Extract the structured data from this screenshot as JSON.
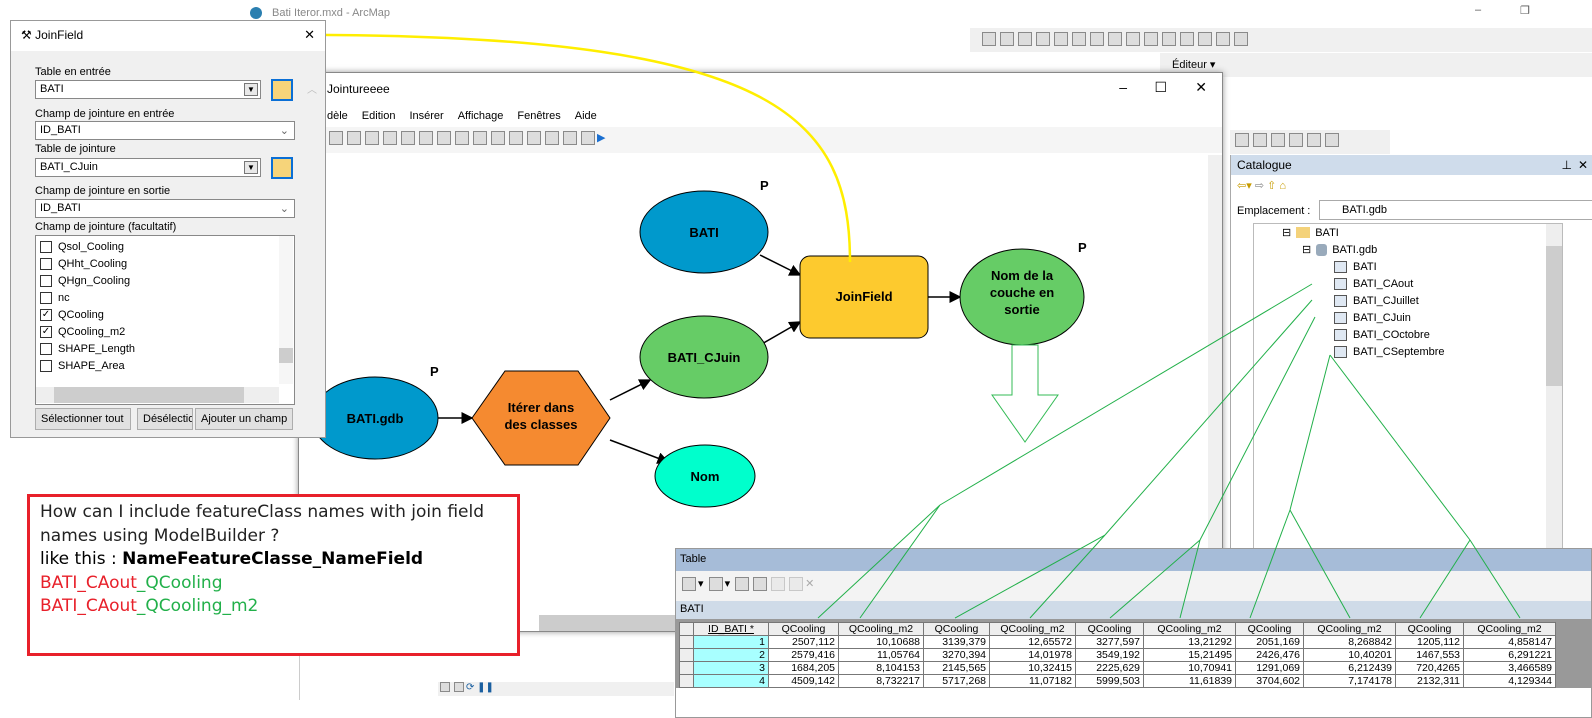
{
  "app": {
    "title": "Bati Iteror.mxd - ArcMap",
    "editor_label": "Éditeur ▾"
  },
  "joinfield": {
    "title": "JoinField",
    "close": "✕",
    "input_table_label": "Table en entrée",
    "input_table": "BATI",
    "input_field_label": "Champ de jointure en entrée",
    "input_field": "ID_BATI",
    "join_table_label": "Table de jointure",
    "join_table": "BATI_CJuin",
    "output_field_label": "Champ de jointure en sortie",
    "output_field": "ID_BATI",
    "fields_label": "Champ de jointure (facultatif)",
    "fields": [
      {
        "name": "Qsol_Cooling",
        "checked": false
      },
      {
        "name": "QHht_Cooling",
        "checked": false
      },
      {
        "name": "QHgn_Cooling",
        "checked": false
      },
      {
        "name": "nc",
        "checked": false
      },
      {
        "name": "QCooling",
        "checked": true
      },
      {
        "name": "QCooling_m2",
        "checked": true
      },
      {
        "name": "SHAPE_Length",
        "checked": false
      },
      {
        "name": "SHAPE_Area",
        "checked": false
      }
    ],
    "select_all": "Sélectionner tout",
    "deselect": "Désélectionner",
    "add_field": "Ajouter un champ"
  },
  "model": {
    "title": "Jointureeee",
    "menu": [
      "dèle",
      "Edition",
      "Insérer",
      "Affichage",
      "Fenêtres",
      "Aide"
    ],
    "nodes": {
      "bati": "BATI",
      "joinfield": "JoinField",
      "output": "Nom de la couche en sortie",
      "bati_cjuin": "BATI_CJuin",
      "bati_gdb": "BATI.gdb",
      "iterate": "Itérer dans des classes",
      "nom": "Nom",
      "param": "P"
    },
    "colors": {
      "blue": "#0099cc",
      "yellow": "#fdca2e",
      "green": "#66cc66",
      "orange": "#f58a30",
      "cyan": "#00ffcc"
    }
  },
  "catalogue": {
    "title": "Catalogue",
    "location_label": "Emplacement :",
    "location": "BATI.gdb",
    "folder": "BATI",
    "gdb": "BATI.gdb",
    "items": [
      "BATI",
      "BATI_CAout",
      "BATI_CJuillet",
      "BATI_CJuin",
      "BATI_COctobre",
      "BATI_CSeptembre"
    ]
  },
  "table": {
    "title": "Table",
    "layer": "BATI",
    "headers": [
      "ID_BATI *",
      "QCooling",
      "QCooling_m2",
      "QCooling",
      "QCooling_m2",
      "QCooling",
      "QCooling_m2",
      "QCooling",
      "QCooling_m2",
      "QCooling",
      "QCooling_m2"
    ],
    "rows": [
      [
        "1",
        "2507,112",
        "10,10688",
        "3139,379",
        "12,65572",
        "3277,597",
        "13,21292",
        "2051,169",
        "8,268842",
        "1205,112",
        "4,858147"
      ],
      [
        "2",
        "2579,416",
        "11,05764",
        "3270,394",
        "14,01978",
        "3549,192",
        "15,21495",
        "2426,476",
        "10,40201",
        "1467,553",
        "6,291221"
      ],
      [
        "3",
        "1684,205",
        "8,104153",
        "2145,565",
        "10,32415",
        "2225,629",
        "10,70941",
        "1291,069",
        "6,212439",
        "720,4265",
        "3,466589"
      ],
      [
        "4",
        "4509,142",
        "8,732217",
        "5717,268",
        "11,07182",
        "5999,503",
        "11,61839",
        "3704,602",
        "7,174178",
        "2132,311",
        "4,129344"
      ]
    ]
  },
  "question": {
    "line1": "How can I include featureClass names with join field names using ModelBuilder ?",
    "like_label": "like this : ",
    "pattern": "NameFeatureClasse_NameField",
    "ex1_fc": "BATI_CAout",
    "ex1_field": "_QCooling",
    "ex2_fc": "BATI_CAout",
    "ex2_field": "_QCooling_m2"
  }
}
